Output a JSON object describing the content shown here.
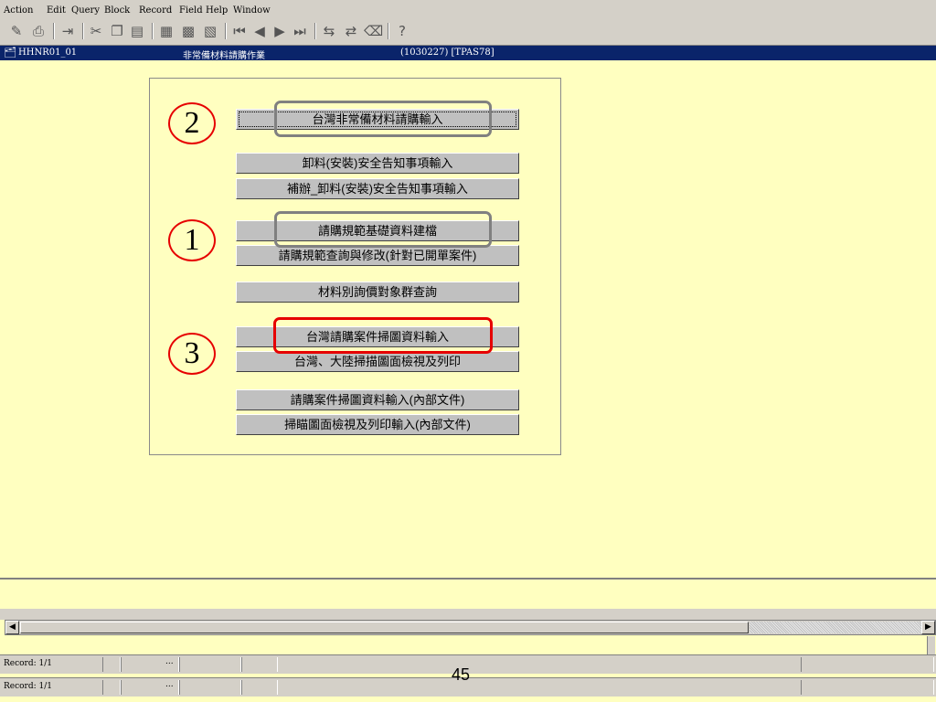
{
  "menu": [
    "Action",
    "Edit",
    "Query",
    "Block",
    "Record",
    "Field",
    "Help",
    "Window"
  ],
  "toolbar": {
    "icons": [
      "save-icon",
      "print-icon",
      "exit-icon",
      "cut-icon",
      "copy-icon",
      "paste-icon",
      "enter-query-icon",
      "execute-query-icon",
      "cancel-query-icon",
      "first-record-icon",
      "previous-record-icon",
      "next-record-icon",
      "last-record-icon",
      "insert-record-icon",
      "delete-record-icon",
      "clear-record-icon",
      "help-icon"
    ],
    "help_glyph": "?"
  },
  "title_bar": {
    "form_name": "HHNR01_01",
    "form_title": "非常備材料請購作業",
    "user_info": "(1030227) [TPAS78]"
  },
  "panel": {
    "buttons": [
      {
        "id": "tw-material-input",
        "label": "台灣非常備材料請購輸入"
      },
      {
        "id": "unload-safety-input",
        "label": "卸料(安裝)安全告知事項輸入"
      },
      {
        "id": "supplement-unload-safety-input",
        "label": "補辦_卸料(安裝)安全告知事項輸入"
      },
      {
        "id": "spec-base-data",
        "label": "請購規範基礎資料建檔"
      },
      {
        "id": "spec-query-edit",
        "label": "請購規範查詢與修改(針對已開單案件)"
      },
      {
        "id": "material-inquiry-group",
        "label": "材料別詢價對象群查詢"
      },
      {
        "id": "tw-scan-input",
        "label": "台灣請購案件掃圖資料輸入"
      },
      {
        "id": "scan-view-print",
        "label": "台灣、大陸掃描圖面檢視及列印"
      },
      {
        "id": "scan-input-internal",
        "label": "請購案件掃圖資料輸入(內部文件)"
      },
      {
        "id": "scan-view-print-internal",
        "label": "掃瞄圖面檢視及列印輸入(內部文件)"
      }
    ],
    "markers": [
      "2",
      "1",
      "3"
    ]
  },
  "status": {
    "record_1": "Record: 1/1",
    "record_2": "Record: 1/1",
    "dots": "..."
  },
  "page_number": "45",
  "colors": {
    "background": "#ffffc0",
    "title_bar": "#0a246a",
    "marker_red": "#e60000",
    "callout_gray": "#808080"
  }
}
